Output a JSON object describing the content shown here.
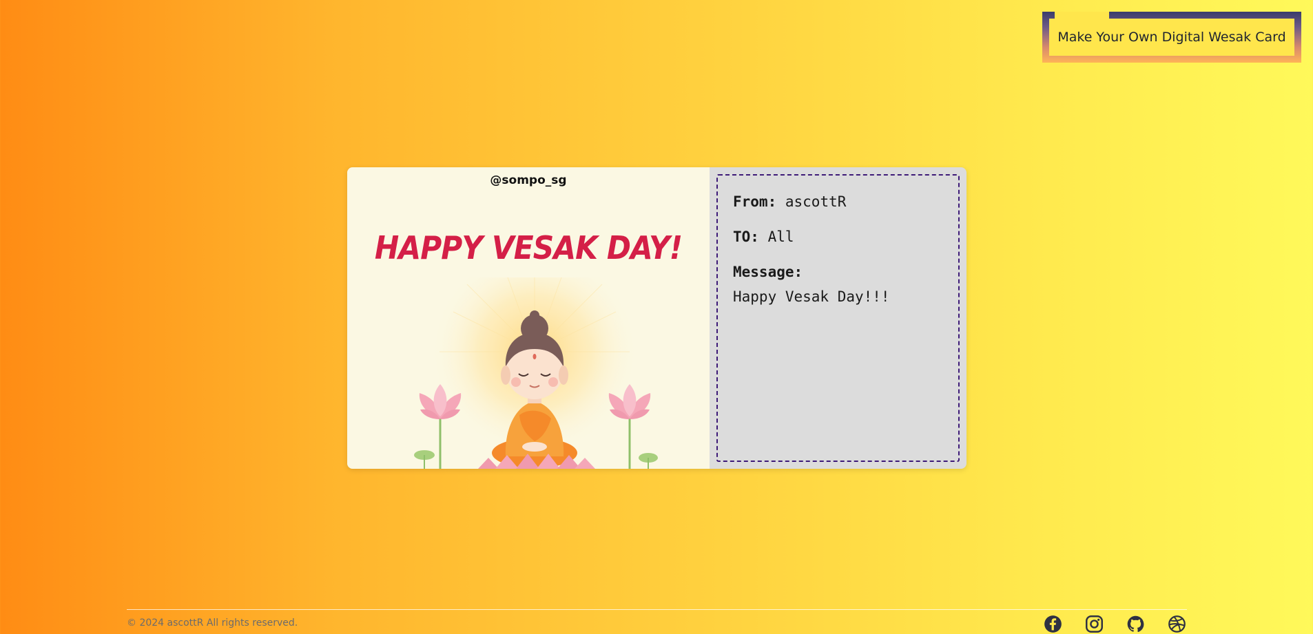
{
  "header": {
    "cta_label": "Make Your Own Digital Wesak Card"
  },
  "card": {
    "handle": "@sompo_sg",
    "greeting": "HAPPY VESAK DAY!",
    "from_label": "From:",
    "from_value": "ascottR",
    "to_label": "TO:",
    "to_value": "All",
    "message_label": "Message:",
    "message_value": "Happy Vesak Day!!!"
  },
  "footer": {
    "copyright": "© 2024 ascottR All rights reserved.",
    "social_icons": [
      "facebook-icon",
      "instagram-icon",
      "github-icon",
      "dribbble-icon"
    ]
  },
  "colors": {
    "background_start": "#ff8c14",
    "background_end": "#fff95a",
    "greeting": "#d41f47",
    "icon": "#2f3142",
    "message_border": "#3d1a78"
  }
}
